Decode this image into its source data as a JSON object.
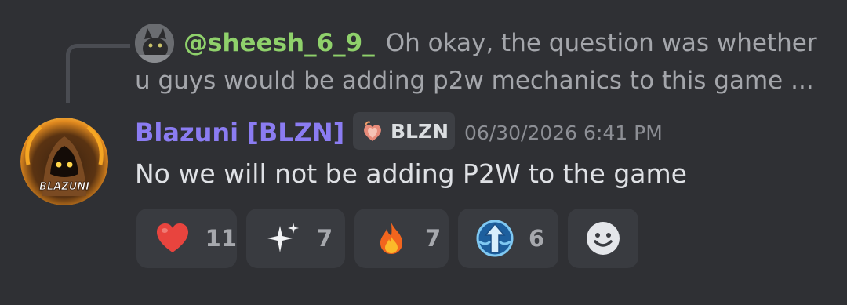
{
  "reply": {
    "mention": "@sheesh_6_9_",
    "line1": "Oh okay, the question was whether",
    "line2": "u guys would be adding p2w mechanics to this game ..."
  },
  "message": {
    "author": "Blazuni [BLZN]",
    "server_tag": "BLZN",
    "timestamp": "06/30/2026 6:41 PM",
    "text": "No we will not be adding P2W to the game",
    "avatar_text": "BLAZUNI"
  },
  "reactions": [
    {
      "icon": "heart-icon",
      "count": "11"
    },
    {
      "icon": "sparkles-icon",
      "count": "7"
    },
    {
      "icon": "fire-icon",
      "count": "7"
    },
    {
      "icon": "upgrade-arrow-icon",
      "count": "6"
    }
  ],
  "colors": {
    "background": "#2f3034",
    "author": "#8b7cf2",
    "mention": "#8fd16b",
    "reaction_bg": "#393b40",
    "muted_text": "#a4a6ab"
  }
}
